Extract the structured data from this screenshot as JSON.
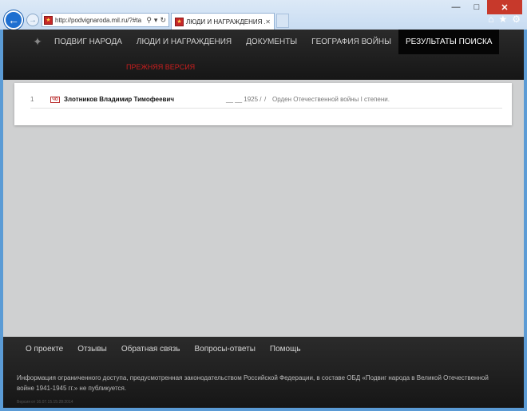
{
  "browser": {
    "url": "http://podvignaroda.mil.ru/?#ta",
    "tab_title": "ЛЮДИ И НАГРАЖДЕНИЯ ...",
    "favicon_glyph": "★",
    "minimize": "—",
    "maximize": "□",
    "close": "✕",
    "back": "←",
    "forward": "→",
    "search_glyph": "⚲",
    "dropdown_glyph": "▾",
    "refresh_glyph": "↻",
    "tab_close": "✕",
    "home_glyph": "⌂",
    "star_glyph": "★",
    "gear_glyph": "⚙"
  },
  "nav": {
    "emblem_glyph": "✦",
    "items": [
      "ПОДВИГ НАРОДА",
      "ЛЮДИ И НАГРАЖДЕНИЯ",
      "ДОКУМЕНТЫ",
      "ГЕОГРАФИЯ ВОЙНЫ",
      "РЕЗУЛЬТАТЫ ПОИСКА"
    ],
    "active_index": 4,
    "previous_version": "ПРЕЖНЯЯ ВЕРСИЯ"
  },
  "results": [
    {
      "number": "1",
      "icon_label": "ЧО",
      "name": "Злотников Владимир Тимофеевич",
      "birth": "__ __ 1925 /",
      "separator": "/",
      "award": "Орден Отечественной войны I степени."
    }
  ],
  "footer": {
    "links": [
      "О проекте",
      "Отзывы",
      "Обратная связь",
      "Вопросы-ответы",
      "Помощь"
    ],
    "note": "Информация ограниченного доступа, предусмотренная законодательством Российской Федерации, в составе ОБД «Подвиг народа в Великой Отечественной войне 1941-1945 гг.» не публикуется.",
    "version": "Версия от 16.07.15.15:28:2014"
  },
  "colors": {
    "accent_red": "#c81e1e",
    "nav_bg": "#1c1c1c",
    "page_bg": "#cfd0d1"
  }
}
